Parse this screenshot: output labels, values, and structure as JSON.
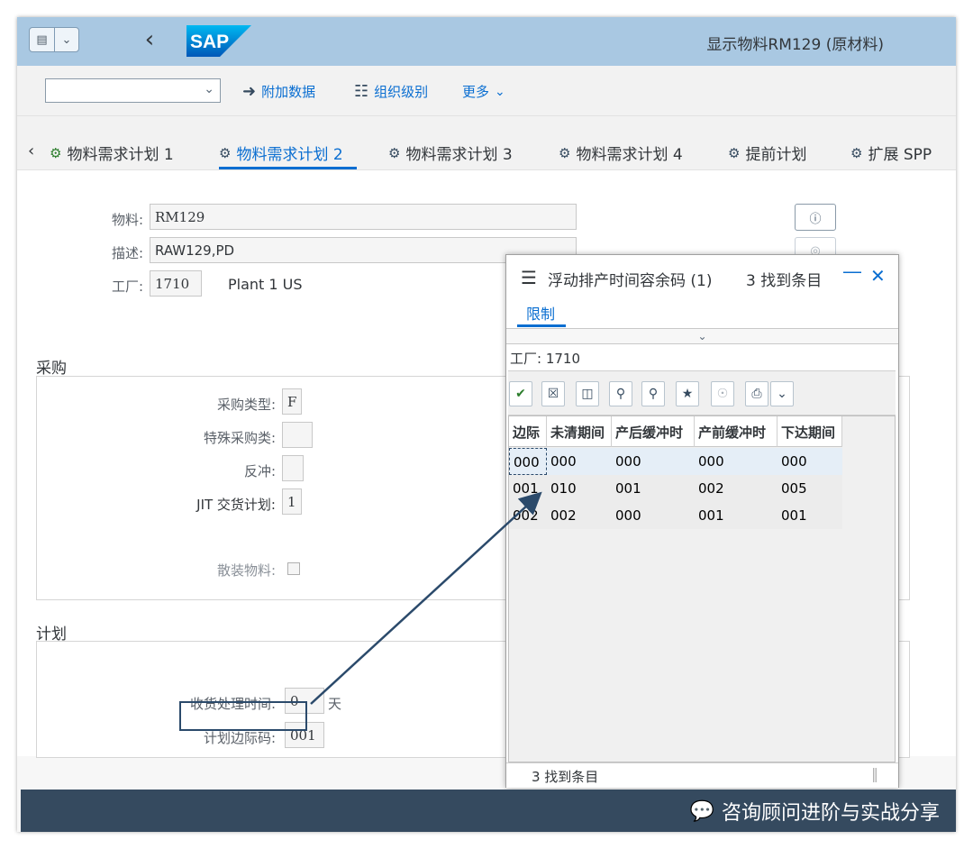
{
  "shell": {
    "title": "显示物料RM129 (原材料)",
    "logo_text": "SAP"
  },
  "toolbar": {
    "select_value": "",
    "additional_data": "附加数据",
    "org_levels": "组织级别",
    "more": "更多"
  },
  "tabs": [
    {
      "label": "物料需求计划 1"
    },
    {
      "label": "物料需求计划 2"
    },
    {
      "label": "物料需求计划 3"
    },
    {
      "label": "物料需求计划 4"
    },
    {
      "label": "提前计划"
    },
    {
      "label": "扩展 SPP"
    }
  ],
  "header_fields": {
    "material_label": "物料:",
    "material_value": "RM129",
    "desc_label": "描述:",
    "desc_value": "RAW129,PD",
    "plant_label": "工厂:",
    "plant_value": "1710",
    "plant_name": "Plant 1 US"
  },
  "procurement": {
    "title": "采购",
    "proc_type_label": "采购类型:",
    "proc_type_value": "F",
    "special_proc_label": "特殊采购类:",
    "special_proc_value": "",
    "backflush_label": "反冲:",
    "backflush_value": "",
    "jit_label": "JIT 交货计划:",
    "jit_value": "1",
    "bulk_label": "散装物料:"
  },
  "planning": {
    "title": "计划",
    "gr_time_label": "收货处理时间:",
    "gr_time_value": "0",
    "gr_time_unit": "天",
    "sm_key_label": "计划边际码:",
    "sm_key_value": "001"
  },
  "popup": {
    "title": "浮动排产时间容余码 (1)",
    "count": "3 找到条目",
    "tab_label": "限制",
    "criteria": "工厂: 1710",
    "columns": [
      "边际",
      "未清期间",
      "产后缓冲时",
      "产前缓冲时",
      "下达期间"
    ],
    "rows": [
      [
        "000",
        "000",
        "000",
        "000",
        "000"
      ],
      [
        "001",
        "010",
        "001",
        "002",
        "005"
      ],
      [
        "002",
        "002",
        "000",
        "001",
        "001"
      ]
    ],
    "footer": "3 找到条目"
  },
  "watermark": {
    "text": "咨询顾问进阶与实战分享"
  },
  "colors": {
    "shell_bg": "#a9c8e2",
    "accent": "#0a6ed1",
    "bottom_bar": "#354a5f",
    "annotation": "#2b4a6b"
  }
}
